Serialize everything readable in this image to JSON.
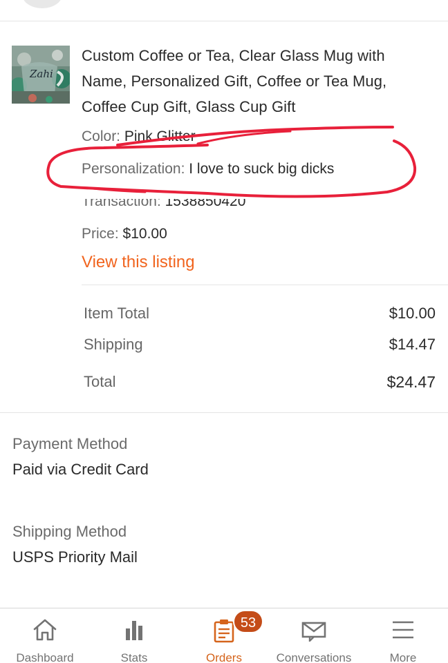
{
  "item": {
    "title": "Custom Coffee or Tea, Clear Glass Mug with Name, Personalized Gift, Coffee or Tea Mug, Coffee Cup Gift, Glass Cup Gift",
    "thumbnail_text": "Zahi",
    "color_label": "Color:",
    "color_value": "Pink Glitter",
    "personalization_label": "Personalization:",
    "personalization_value": "I love to suck big dicks",
    "transaction_label": "Transaction:",
    "transaction_value": "1538850420",
    "price_label": "Price:",
    "price_value": "$10.00",
    "view_link": "View this listing"
  },
  "totals": {
    "item_total_label": "Item Total",
    "item_total_value": "$10.00",
    "shipping_label": "Shipping",
    "shipping_value": "$14.47",
    "total_label": "Total",
    "total_value": "$24.47"
  },
  "payment": {
    "label": "Payment Method",
    "value": "Paid via Credit Card"
  },
  "shipping_method": {
    "label": "Shipping Method",
    "value": "USPS Priority Mail"
  },
  "tabbar": {
    "tabs": [
      {
        "label": "Dashboard",
        "icon": "home-icon"
      },
      {
        "label": "Stats",
        "icon": "bar-chart-icon"
      },
      {
        "label": "Orders",
        "icon": "clipboard-icon",
        "active": true
      },
      {
        "label": "Conversations",
        "icon": "envelope-icon"
      },
      {
        "label": "More",
        "icon": "menu-icon"
      }
    ],
    "orders_badge": "53"
  },
  "colors": {
    "accent": "#f1641e",
    "active_tab": "#d5641c",
    "badge": "#c44c18",
    "marker": "#e8203a"
  }
}
